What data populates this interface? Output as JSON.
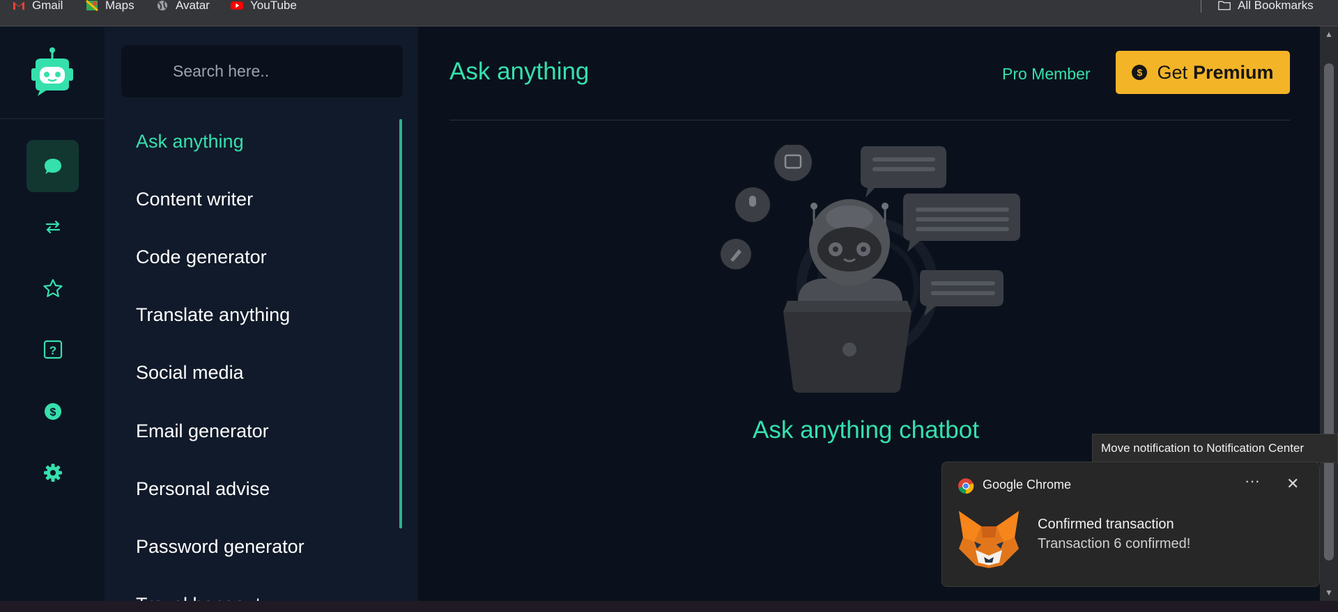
{
  "bookmarks": [
    {
      "label": "Gmail",
      "icon": "gmail-icon"
    },
    {
      "label": "Maps",
      "icon": "maps-icon"
    },
    {
      "label": "Avatar",
      "icon": "globe-icon"
    },
    {
      "label": "YouTube",
      "icon": "youtube-icon"
    }
  ],
  "all_bookmarks": "All Bookmarks",
  "sidebar": {
    "search_placeholder": "Search here..",
    "items": [
      {
        "label": "Ask anything"
      },
      {
        "label": "Content writer"
      },
      {
        "label": "Code generator"
      },
      {
        "label": "Translate anything"
      },
      {
        "label": "Social media"
      },
      {
        "label": "Email generator"
      },
      {
        "label": "Personal advise"
      },
      {
        "label": "Password generator"
      },
      {
        "label": "Travel hangout"
      }
    ]
  },
  "rail": {
    "icons": [
      "chat-icon",
      "swap-icon",
      "star-icon",
      "help-icon",
      "dollar-icon",
      "gear-icon"
    ]
  },
  "header": {
    "title": "Ask anything",
    "pro_label": "Pro Member",
    "premium_prefix": "Get",
    "premium_bold": "Premium"
  },
  "main": {
    "chat_title": "Ask anything chatbot"
  },
  "notification": {
    "tooltip": "Move notification to Notification Center",
    "app": "Google Chrome",
    "more": "···",
    "close": "✕",
    "title": "Confirmed transaction",
    "body": "Transaction 6 confirmed!"
  },
  "colors": {
    "accent": "#35e0ad",
    "premium": "#f3b427",
    "background": "#0b111c"
  }
}
